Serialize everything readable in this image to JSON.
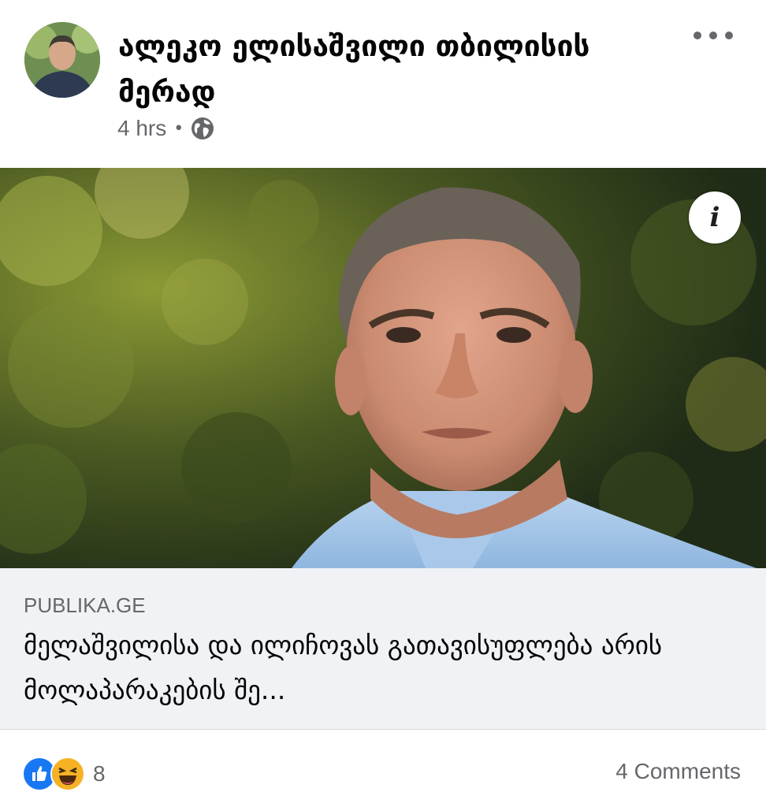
{
  "post": {
    "author": "ალეკო ელისაშვილი თბილისის მერად",
    "time": "4 hrs",
    "separator": "•",
    "visibility_icon": "globe-icon",
    "more_icon": "more-options-icon"
  },
  "photo": {
    "description_icon": "info-icon",
    "info_label": "i"
  },
  "link": {
    "domain": "PUBLIKA.GE",
    "title": "მელაშვილისა და ილიჩოვას გათავისუფლება არის მოლაპარაკების შე..."
  },
  "footer": {
    "reaction_icons": [
      "like-icon",
      "haha-icon"
    ],
    "reaction_count": "8",
    "comments": "4 Comments"
  },
  "colors": {
    "secondary_text": "#65676b",
    "like_blue": "#1877f2",
    "haha_yellow": "#f7b125",
    "preview_bg": "#f0f2f5"
  }
}
